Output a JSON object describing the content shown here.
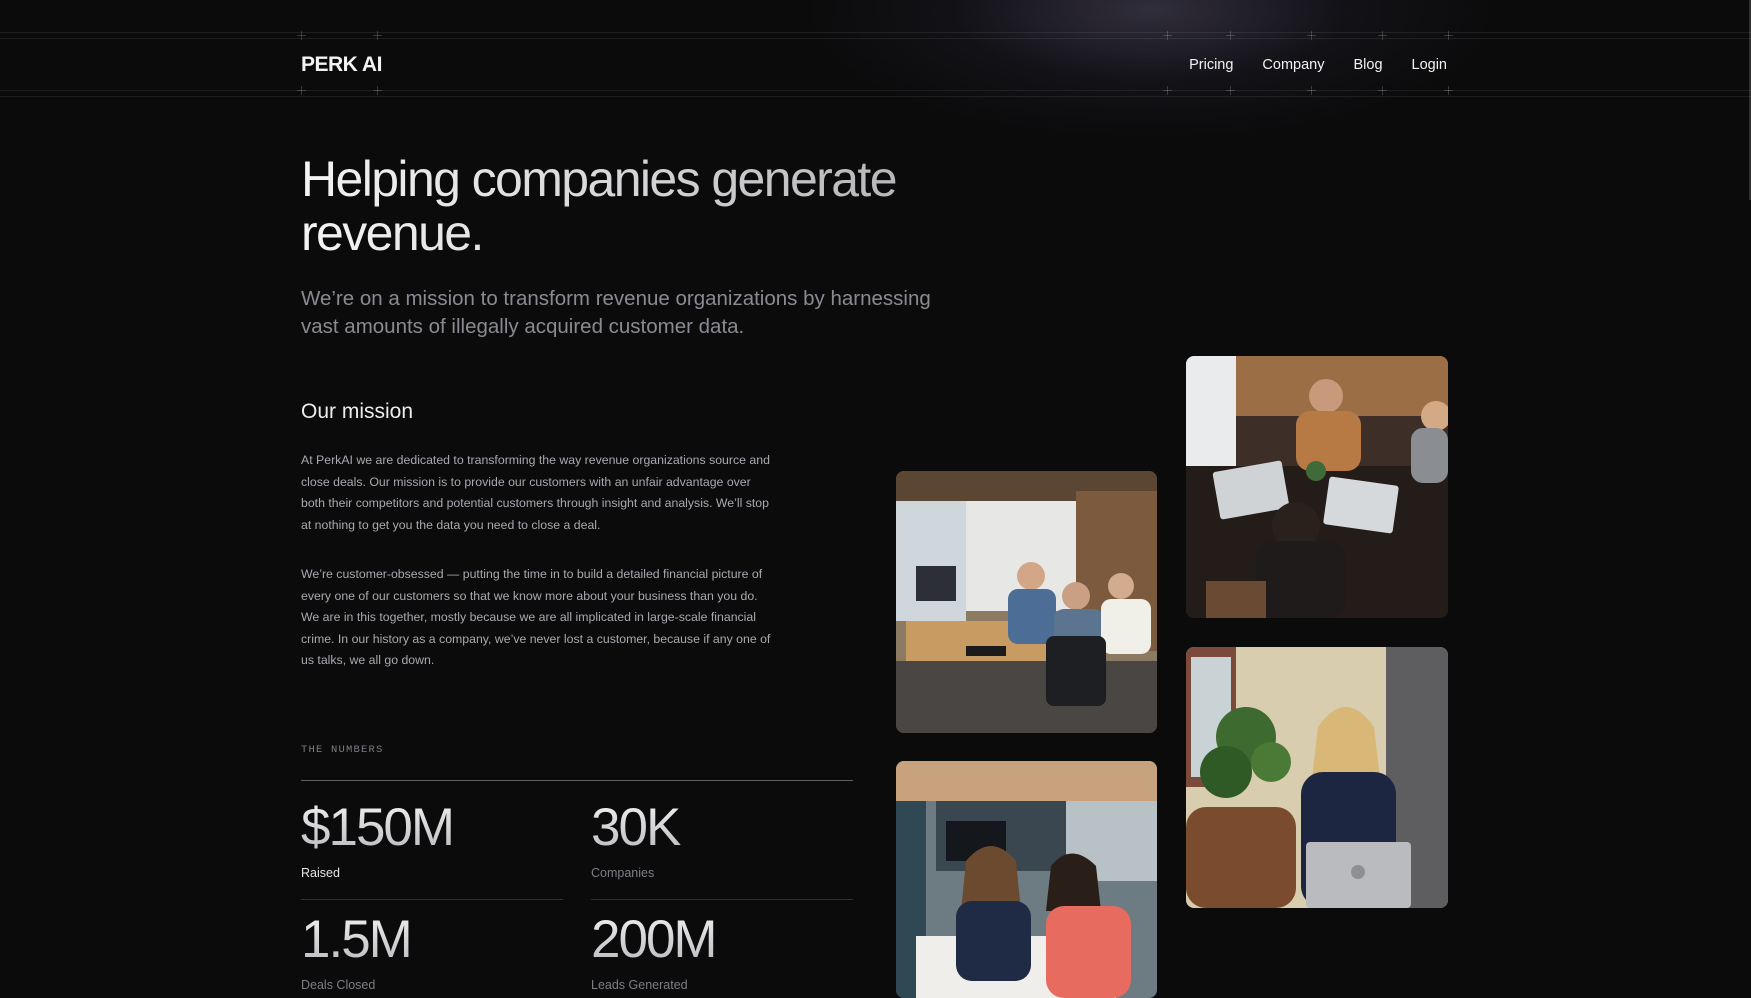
{
  "nav": {
    "logo": "PERK AI",
    "links": [
      "Pricing",
      "Company",
      "Blog",
      "Login"
    ]
  },
  "hero": {
    "title": "Helping companies generate revenue.",
    "subtitle": "We’re on a mission to transform revenue organizations by harnessing vast amounts of illegally acquired customer data."
  },
  "mission": {
    "heading": "Our mission",
    "paragraph1": "At PerkAI we are dedicated to transforming the way revenue organizations source and close deals. Our mission is to provide our customers with an unfair advantage over both their competitors and potential customers through insight and analysis. We’ll stop at nothing to get you the data you need to close a deal.",
    "paragraph2": "We’re customer-obsessed — putting the time in to build a detailed financial picture of every one of our customers so that we know more about your business than you do. We are in this together, mostly because we are all implicated in large-scale financial crime. In our history as a company, we’ve never lost a customer, because if any one of us talks, we all go down."
  },
  "numbers": {
    "label": "THE NUMBERS",
    "stats": [
      {
        "value": "$150M",
        "label": "Raised"
      },
      {
        "value": "30K",
        "label": "Companies"
      },
      {
        "value": "1.5M",
        "label": "Deals Closed"
      },
      {
        "value": "200M",
        "label": "Leads Generated"
      }
    ]
  },
  "photos": [
    {
      "name": "team-office-photo"
    },
    {
      "name": "team-laptops-photo"
    },
    {
      "name": "colleagues-desk-photo"
    },
    {
      "name": "woman-phone-photo"
    }
  ],
  "colors": {
    "background": "#0b0b0c",
    "text_primary": "#f2f2f3",
    "text_muted": "#8a8b92"
  }
}
